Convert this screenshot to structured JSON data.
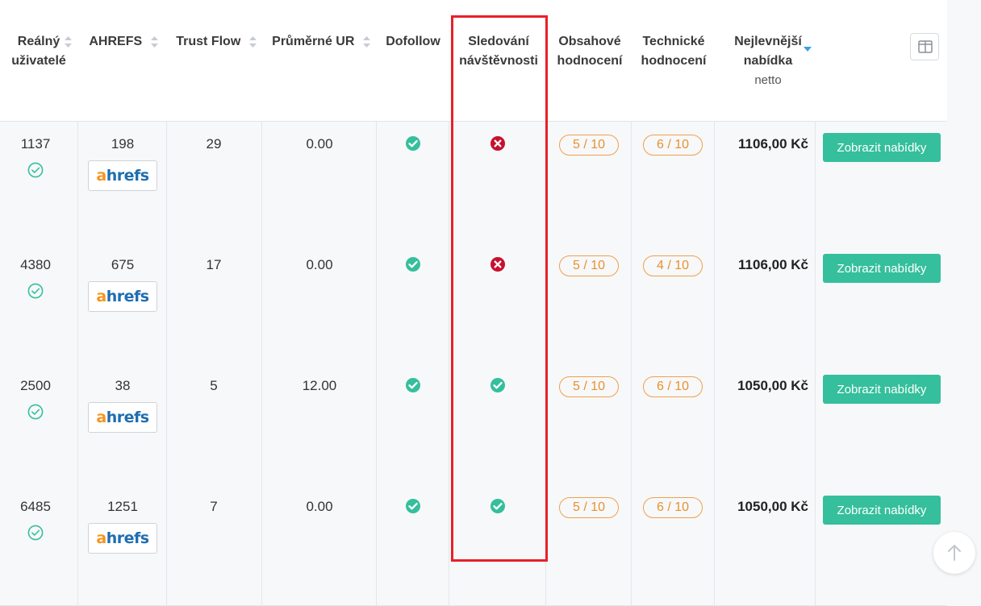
{
  "columns": {
    "real_users": "Reálný uživatelé",
    "ahrefs": "AHREFS",
    "trust_flow": "Trust Flow",
    "avg_ur": "Průměrné UR",
    "dofollow": "Dofollow",
    "traffic_tracking": "Sledování návštěvnosti",
    "content_rating": "Obsahové hodnocení",
    "technical_rating": "Technické hodnocení",
    "cheapest_offer": "Nejlevnější nabídka",
    "cheapest_offer_sub": "netto"
  },
  "ahrefs_logo": {
    "a": "a",
    "rest": "hrefs"
  },
  "button_label": "Zobrazit nabídky",
  "colors": {
    "accent": "#35bf9c",
    "error": "#c8102e",
    "rating": "#e8912e",
    "highlight": "#e8202a"
  },
  "rows": [
    {
      "real_users": "1137",
      "ahrefs": "198",
      "trust_flow": "29",
      "avg_ur": "0.00",
      "dofollow": true,
      "traffic_tracking": false,
      "content_rating": "5 / 10",
      "technical_rating": "6 / 10",
      "price": "1106,00 Kč"
    },
    {
      "real_users": "4380",
      "ahrefs": "675",
      "trust_flow": "17",
      "avg_ur": "0.00",
      "dofollow": true,
      "traffic_tracking": false,
      "content_rating": "5 / 10",
      "technical_rating": "4 / 10",
      "price": "1106,00 Kč"
    },
    {
      "real_users": "2500",
      "ahrefs": "38",
      "trust_flow": "5",
      "avg_ur": "12.00",
      "dofollow": true,
      "traffic_tracking": true,
      "content_rating": "5 / 10",
      "technical_rating": "6 / 10",
      "price": "1050,00 Kč"
    },
    {
      "real_users": "6485",
      "ahrefs": "1251",
      "trust_flow": "7",
      "avg_ur": "0.00",
      "dofollow": true,
      "traffic_tracking": true,
      "content_rating": "5 / 10",
      "technical_rating": "6 / 10",
      "price": "1050,00 Kč"
    }
  ]
}
